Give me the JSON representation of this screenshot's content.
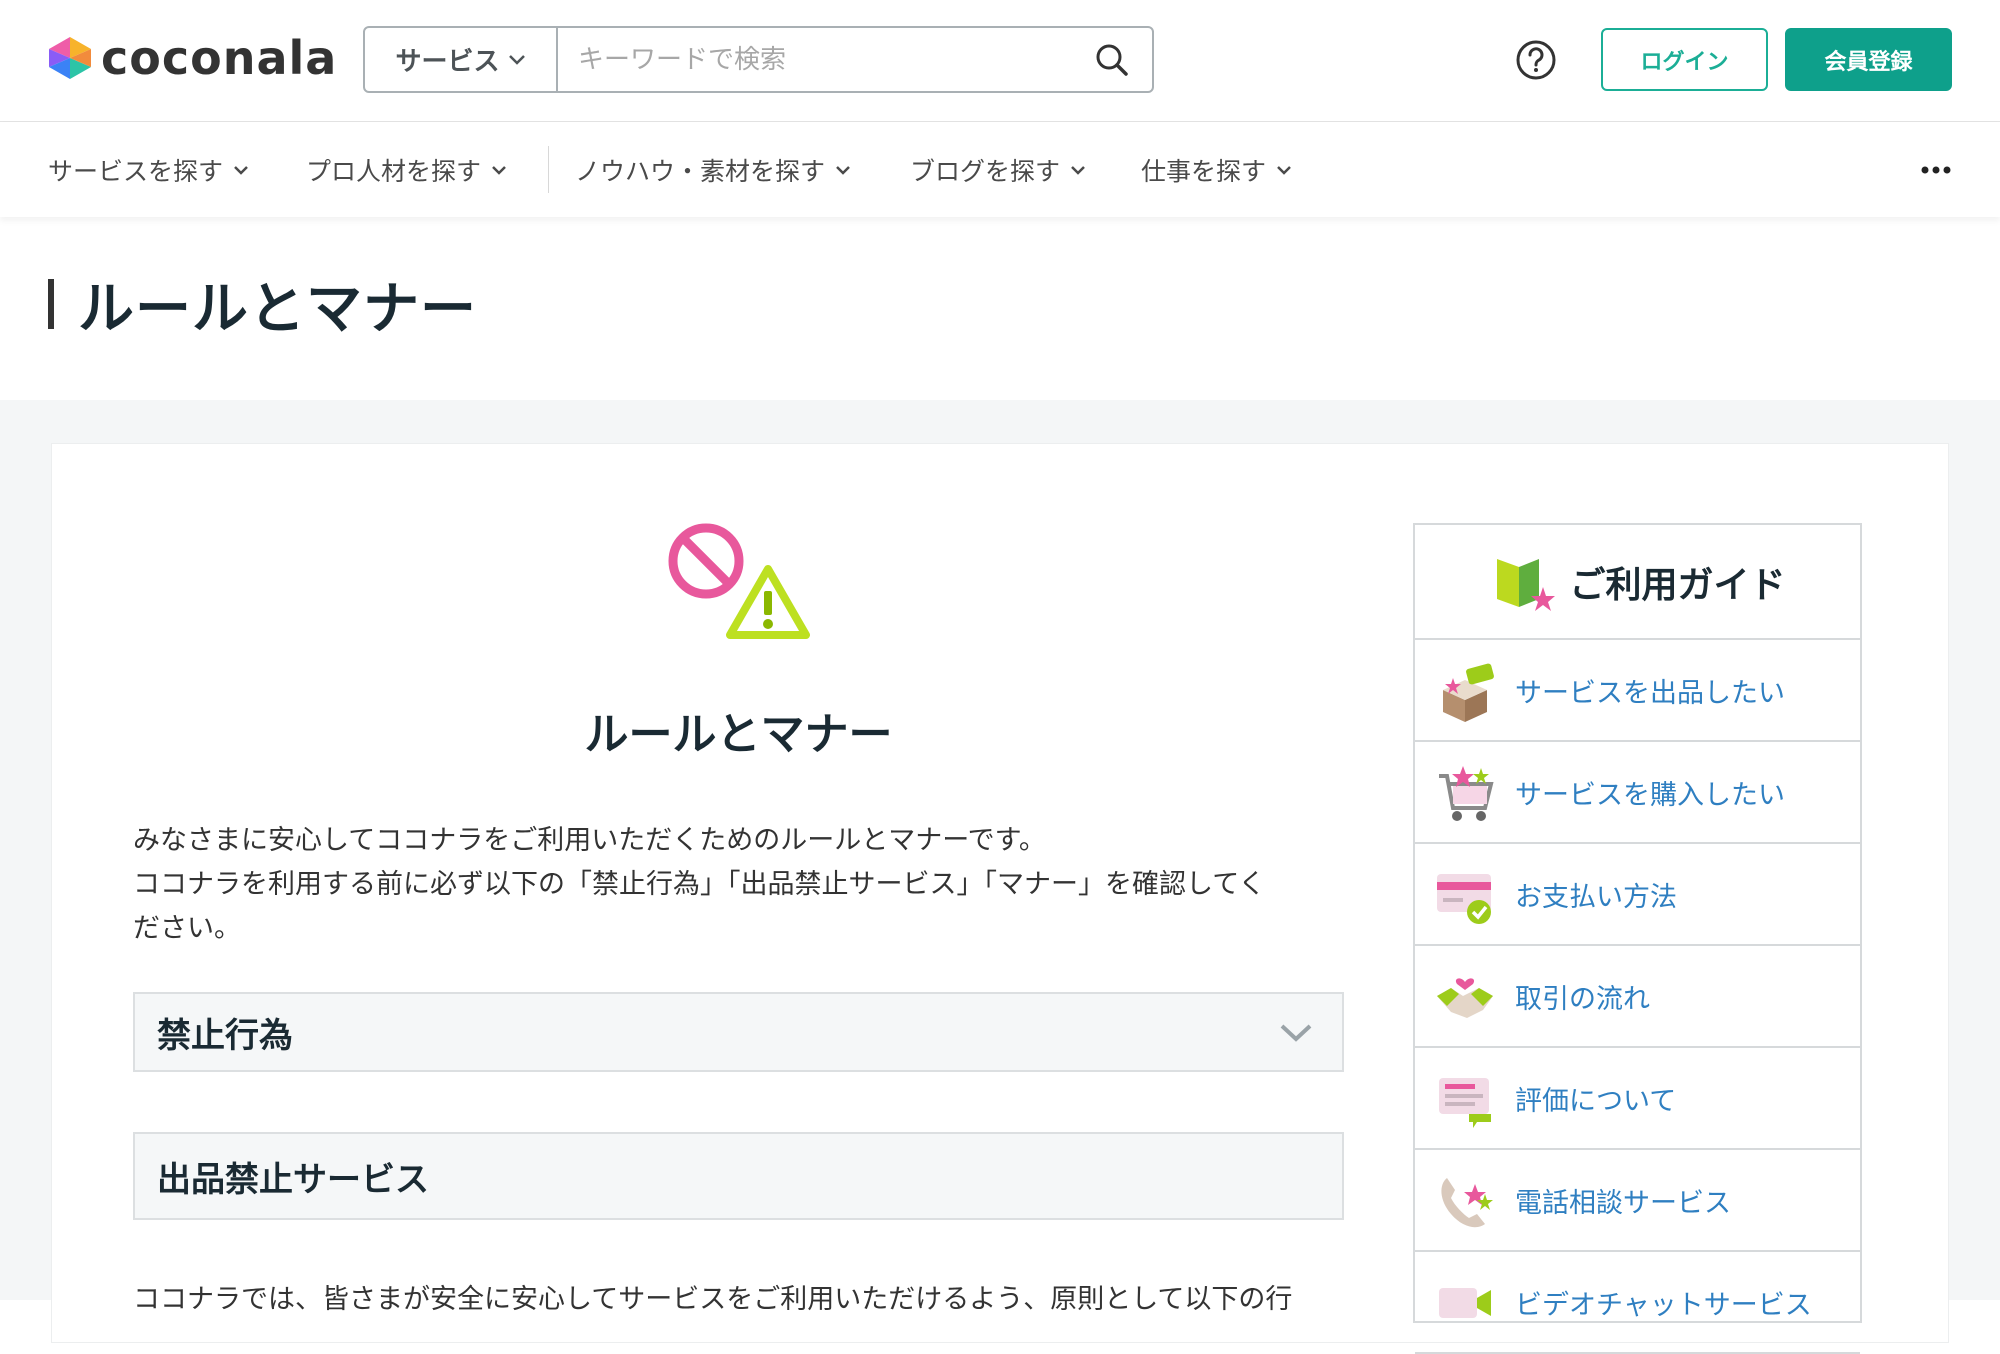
{
  "header": {
    "logo_text": "coconala",
    "search": {
      "category": "サービス",
      "placeholder": "キーワードで検索"
    },
    "help_icon": "question-circle-icon",
    "login_label": "ログイン",
    "register_label": "会員登録"
  },
  "catnav": {
    "items": [
      {
        "label": "サービスを探す"
      },
      {
        "label": "プロ人材を探す"
      },
      {
        "label": "ノウハウ・素材を探す"
      },
      {
        "label": "ブログを探す"
      },
      {
        "label": "仕事を探す"
      }
    ],
    "more_icon": "more-horizontal-icon"
  },
  "page": {
    "title": "ルールとマナー"
  },
  "main": {
    "hero_title": "ルールとマナー",
    "intro_line1": "みなさまに安心してココナラをご利用いただくためのルールとマナーです。",
    "intro_line2": "ココナラを利用する前に必ず以下の「禁止行為」「出品禁止サービス」「マナー」を確認してく",
    "intro_line3": "ださい。",
    "accordion": [
      {
        "title": "禁止行為"
      },
      {
        "title": "出品禁止サービス"
      }
    ],
    "bottom_text": "ココナラでは、皆さまが安全に安心してサービスをご利用いただけるよう、原則として以下の行"
  },
  "guide": {
    "title": "ご利用ガイド",
    "items": [
      {
        "label": "サービスを出品したい",
        "icon": "open-box-icon"
      },
      {
        "label": "サービスを購入したい",
        "icon": "shopping-cart-icon"
      },
      {
        "label": "お支払い方法",
        "icon": "credit-card-icon"
      },
      {
        "label": "取引の流れ",
        "icon": "handshake-icon"
      },
      {
        "label": "評価について",
        "icon": "review-card-icon"
      },
      {
        "label": "電話相談サービス",
        "icon": "phone-icon"
      },
      {
        "label": "ビデオチャットサービス",
        "icon": "video-icon"
      }
    ]
  },
  "colors": {
    "accent": "#0ea08b",
    "link": "#2f7fc1",
    "heading": "#1a2a33"
  }
}
